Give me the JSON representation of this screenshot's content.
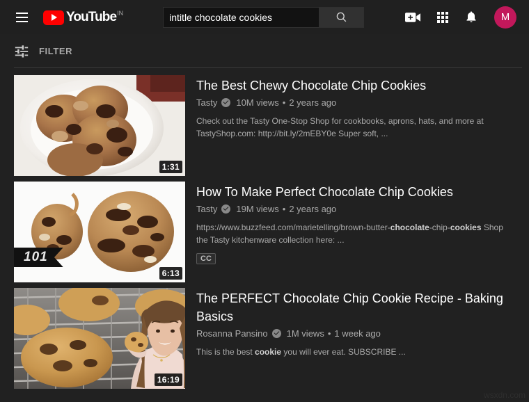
{
  "header": {
    "menu_icon": "hamburger-menu-icon",
    "logo_text": "YouTube",
    "logo_country": "IN",
    "search_value": "intitle chocolate cookies",
    "search_placeholder": "Search",
    "search_icon": "search-icon",
    "create_icon": "create-video-icon",
    "apps_icon": "apps-grid-icon",
    "notifications_icon": "notifications-bell-icon",
    "avatar_initial": "M",
    "avatar_color": "#c2185b",
    "brand_color": "#ff0000"
  },
  "filter": {
    "icon": "tune-sliders-icon",
    "label": "FILTER"
  },
  "results": [
    {
      "title": "The Best Chewy Chocolate Chip Cookies",
      "channel": "Tasty",
      "verified": true,
      "views": "10M views",
      "separator": "•",
      "age": "2 years ago",
      "description_html": "Check out the Tasty One-Stop Shop for cookbooks, aprons, hats, and more at TastyShop.com: http://bit.ly/2mEBY0e Super soft, ...",
      "duration": "1:31",
      "cc": false,
      "thumbnail_alt": "three chocolate chip cookies on a white plate",
      "ribbon": null
    },
    {
      "title": "How To Make Perfect Chocolate Chip Cookies",
      "channel": "Tasty",
      "verified": true,
      "views": "19M views",
      "separator": "•",
      "age": "2 years ago",
      "description_html": "https://www.buzzfeed.com/marietelling/brown-butter-<b>chocolate</b>-chip-<b>cookies</b> Shop the Tasty kitchenware collection here: ...",
      "duration": "6:13",
      "cc": true,
      "cc_label": "CC",
      "thumbnail_alt": "two chocolate chip cookies side by side on white background",
      "ribbon": "101"
    },
    {
      "title": "The PERFECT Chocolate Chip Cookie Recipe - Baking Basics",
      "channel": "Rosanna Pansino",
      "verified": true,
      "views": "1M views",
      "separator": "•",
      "age": "1 week ago",
      "description_html": "This is the best <b>cookie</b> you will ever eat. SUBSCRIBE ...",
      "duration": "16:19",
      "cc": false,
      "thumbnail_alt": "cookies on a cooling rack with woman holding a cookie",
      "ribbon": null
    }
  ],
  "watermark": "wsxdn.com"
}
